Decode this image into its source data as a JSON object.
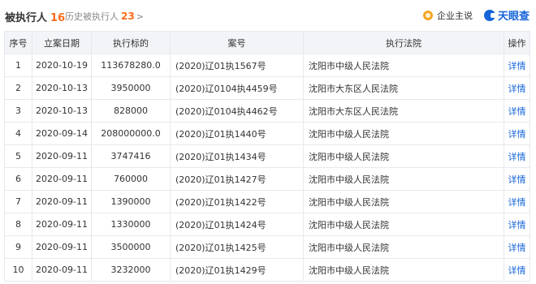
{
  "header": {
    "title": "被执行人",
    "count": "16",
    "history_label": "历史被执行人",
    "history_count": "23",
    "history_chevron": ">",
    "slogan": "企业主说",
    "brand": "天眼查"
  },
  "table": {
    "columns": [
      "序号",
      "立案日期",
      "执行标的",
      "案号",
      "执行法院",
      "操作"
    ],
    "rows": [
      {
        "idx": "1",
        "date": "2020-10-19",
        "amount": "113678280.0",
        "case": "(2020)辽01执1567号",
        "court": "沈阳市中级人民法院",
        "action": "详情"
      },
      {
        "idx": "2",
        "date": "2020-10-13",
        "amount": "3950000",
        "case": "(2020)辽0104执4459号",
        "court": "沈阳市大东区人民法院",
        "action": "详情"
      },
      {
        "idx": "3",
        "date": "2020-10-13",
        "amount": "828000",
        "case": "(2020)辽0104执4462号",
        "court": "沈阳市大东区人民法院",
        "action": "详情"
      },
      {
        "idx": "4",
        "date": "2020-09-14",
        "amount": "208000000.0",
        "case": "(2020)辽01执1440号",
        "court": "沈阳市中级人民法院",
        "action": "详情"
      },
      {
        "idx": "5",
        "date": "2020-09-11",
        "amount": "3747416",
        "case": "(2020)辽01执1434号",
        "court": "沈阳市中级人民法院",
        "action": "详情"
      },
      {
        "idx": "6",
        "date": "2020-09-11",
        "amount": "760000",
        "case": "(2020)辽01执1427号",
        "court": "沈阳市中级人民法院",
        "action": "详情"
      },
      {
        "idx": "7",
        "date": "2020-09-11",
        "amount": "1390000",
        "case": "(2020)辽01执1422号",
        "court": "沈阳市中级人民法院",
        "action": "详情"
      },
      {
        "idx": "8",
        "date": "2020-09-11",
        "amount": "1330000",
        "case": "(2020)辽01执1424号",
        "court": "沈阳市中级人民法院",
        "action": "详情"
      },
      {
        "idx": "9",
        "date": "2020-09-11",
        "amount": "3500000",
        "case": "(2020)辽01执1425号",
        "court": "沈阳市中级人民法院",
        "action": "详情"
      },
      {
        "idx": "10",
        "date": "2020-09-11",
        "amount": "3232000",
        "case": "(2020)辽01执1429号",
        "court": "沈阳市中级人民法院",
        "action": "详情"
      }
    ]
  },
  "colors": {
    "accent_orange": "#ff6b1a",
    "link_blue": "#1665d8",
    "header_bg": "#f2f4f7",
    "border": "#e6e9ed"
  },
  "icons": {
    "slogan_icon": "bulb-icon",
    "brand_icon": "tianyancha-logo-icon",
    "history_chevron": "chevron-right-icon"
  }
}
